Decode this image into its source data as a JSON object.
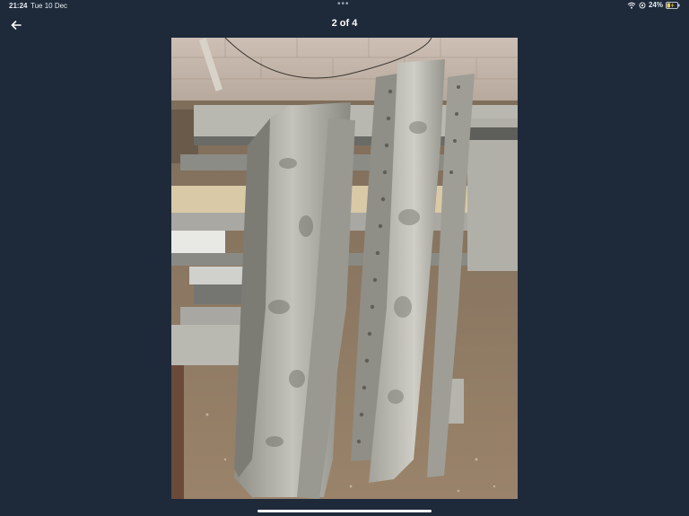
{
  "status_bar": {
    "time": "21:24",
    "date": "Tue 10 Dec",
    "battery_percent": "24%"
  },
  "nav": {
    "page_counter": "2 of 4"
  },
  "colors": {
    "background": "#1e2a3a",
    "text": "#ffffff"
  },
  "icons": {
    "back": "arrow-left-icon",
    "wifi": "wifi-icon",
    "orientation_lock": "orientation-lock-icon",
    "battery": "battery-charging-icon",
    "more": "more-dots-icon"
  }
}
